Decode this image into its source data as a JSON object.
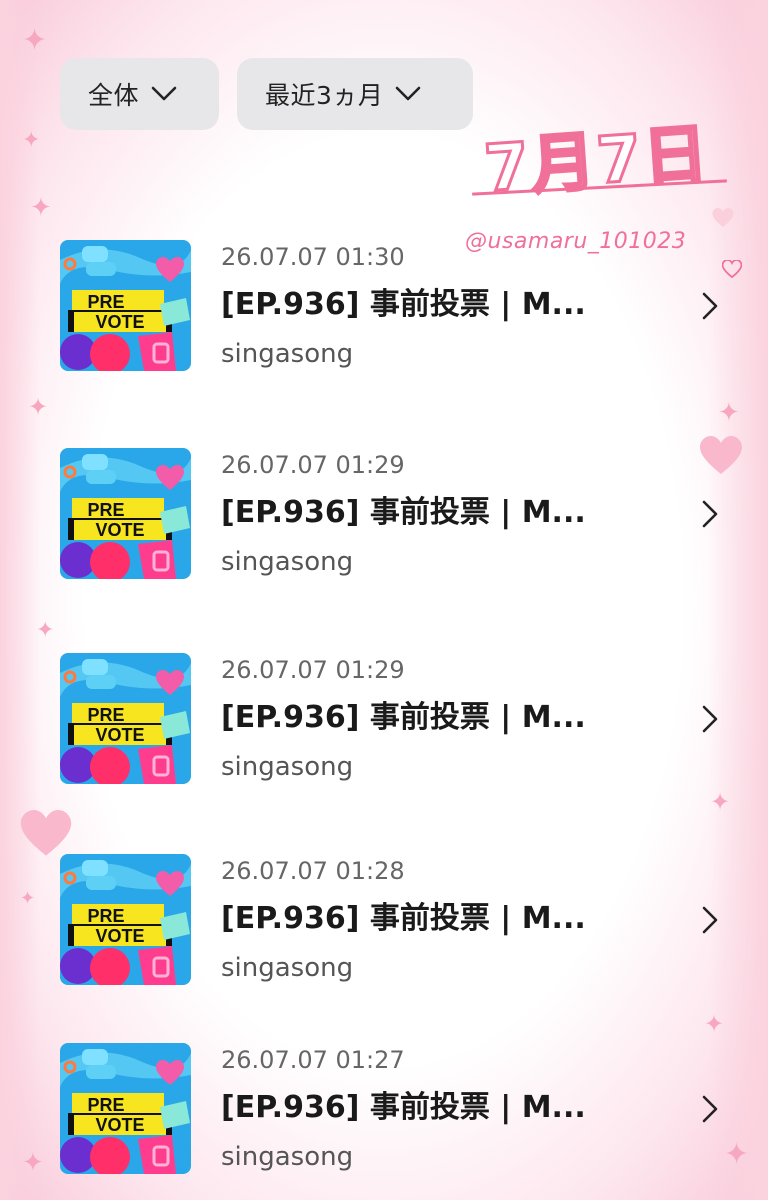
{
  "filters": {
    "type_label": "全体",
    "period_label": "最近3ヵ月"
  },
  "decoration": {
    "date_text": "7月7日",
    "handle_text": "@usamaru_101023"
  },
  "thumbnail": {
    "line1": "PRE",
    "line2": "VOTE"
  },
  "entries": [
    {
      "timestamp": "26.07.07 01:30",
      "title": "[EP.936] 事前投票 | M...",
      "artist": "singasong"
    },
    {
      "timestamp": "26.07.07 01:29",
      "title": "[EP.936] 事前投票 | M...",
      "artist": "singasong"
    },
    {
      "timestamp": "26.07.07 01:29",
      "title": "[EP.936] 事前投票 | M...",
      "artist": "singasong"
    },
    {
      "timestamp": "26.07.07 01:28",
      "title": "[EP.936] 事前投票 | M...",
      "artist": "singasong"
    },
    {
      "timestamp": "26.07.07 01:27",
      "title": "[EP.936] 事前投票 | M...",
      "artist": "singasong"
    }
  ],
  "icons": {
    "filter_toggle": "chevron-down-icon",
    "row_open": "chevron-right-icon"
  },
  "colors": {
    "accent_pink": "#f0709a",
    "chip_bg": "#e7e7ea",
    "thumb_blue": "#2aa7e8",
    "thumb_yellow": "#f6e51f"
  }
}
